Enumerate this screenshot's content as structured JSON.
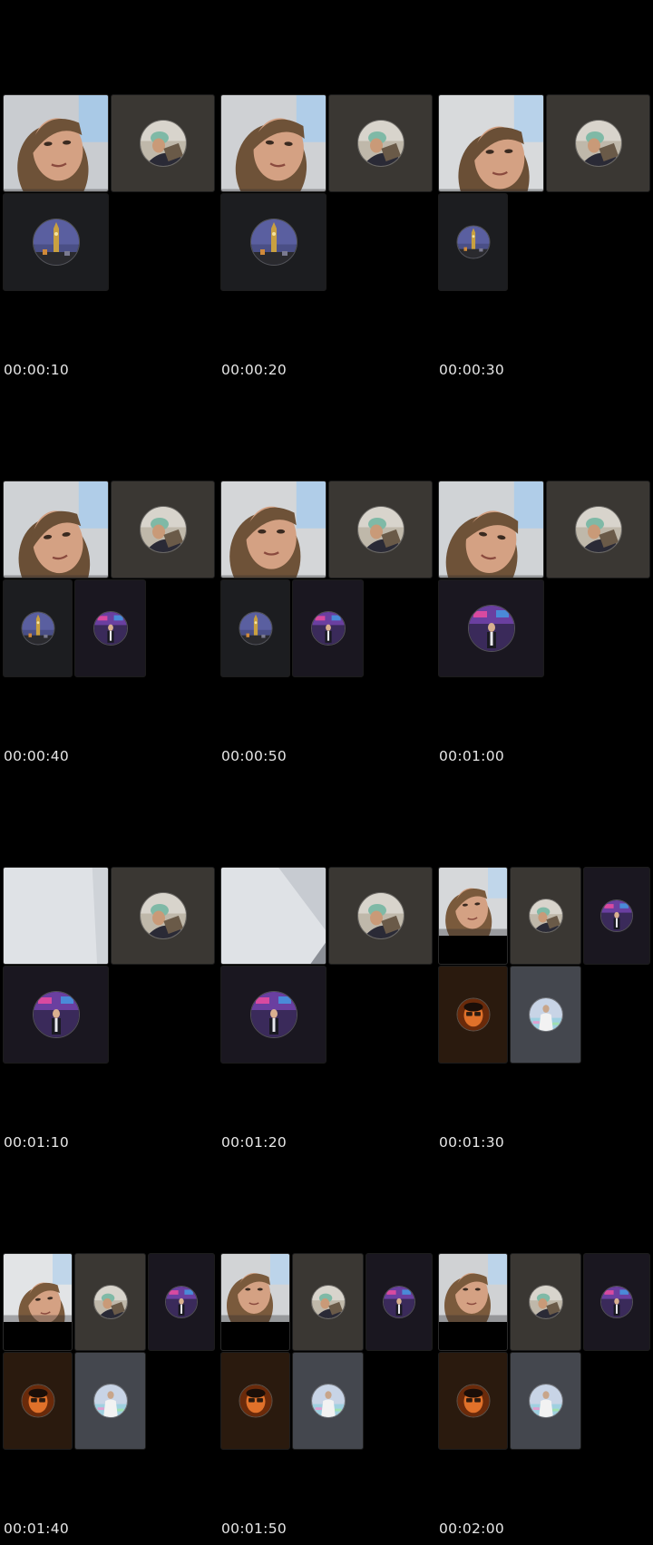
{
  "contact_sheet": {
    "frames": [
      {
        "timestamp": "00:00:10"
      },
      {
        "timestamp": "00:00:20"
      },
      {
        "timestamp": "00:00:30"
      },
      {
        "timestamp": "00:00:40"
      },
      {
        "timestamp": "00:00:50"
      },
      {
        "timestamp": "00:01:00"
      },
      {
        "timestamp": "00:01:10"
      },
      {
        "timestamp": "00:01:20"
      },
      {
        "timestamp": "00:01:30"
      },
      {
        "timestamp": "00:01:40"
      },
      {
        "timestamp": "00:01:50"
      },
      {
        "timestamp": "00:02:00"
      }
    ]
  },
  "colors": {
    "background": "#000000",
    "timestamp_text": "#e6e6e6",
    "tile_user_blue_haired": "#3a3733",
    "tile_user_big_ben": "#1c1d20",
    "tile_user_broadcast": "#1a1720",
    "tile_user_glasses": "#2a1a0e",
    "tile_user_white_shirt": "#44474e"
  },
  "icons": {
    "user_blue_haired": "avatar-blue-hair-icon",
    "user_big_ben": "avatar-big-ben-icon",
    "user_broadcast": "avatar-broadcast-icon",
    "user_glasses": "avatar-glasses-icon",
    "user_white_shirt": "avatar-white-shirt-icon"
  }
}
